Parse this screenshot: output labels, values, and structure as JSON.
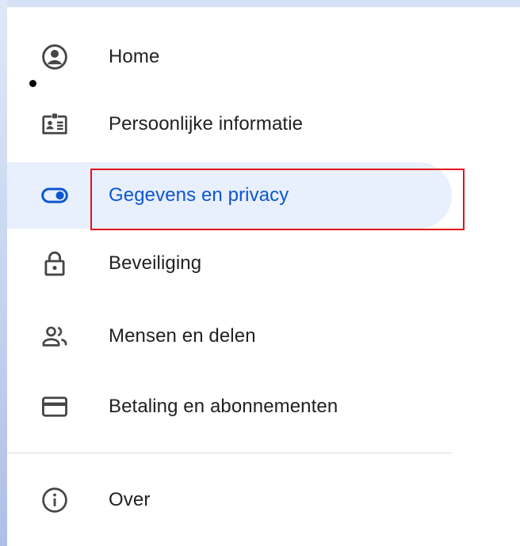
{
  "nav": {
    "items": [
      {
        "label": "Home",
        "icon": "account-circle-icon"
      },
      {
        "label": "Persoonlijke informatie",
        "icon": "id-card-icon"
      },
      {
        "label": "Gegevens en privacy",
        "icon": "toggle-icon",
        "selected": true
      },
      {
        "label": "Beveiliging",
        "icon": "lock-icon"
      },
      {
        "label": "Mensen en delen",
        "icon": "people-icon"
      },
      {
        "label": "Betaling en abonnementen",
        "icon": "credit-card-icon"
      },
      {
        "label": "Over",
        "icon": "info-icon"
      }
    ]
  },
  "colors": {
    "selected_bg": "#e8effd",
    "selected_text": "#0b57d0",
    "text": "#202124",
    "icon": "#444746",
    "highlight": "#e3131b"
  }
}
